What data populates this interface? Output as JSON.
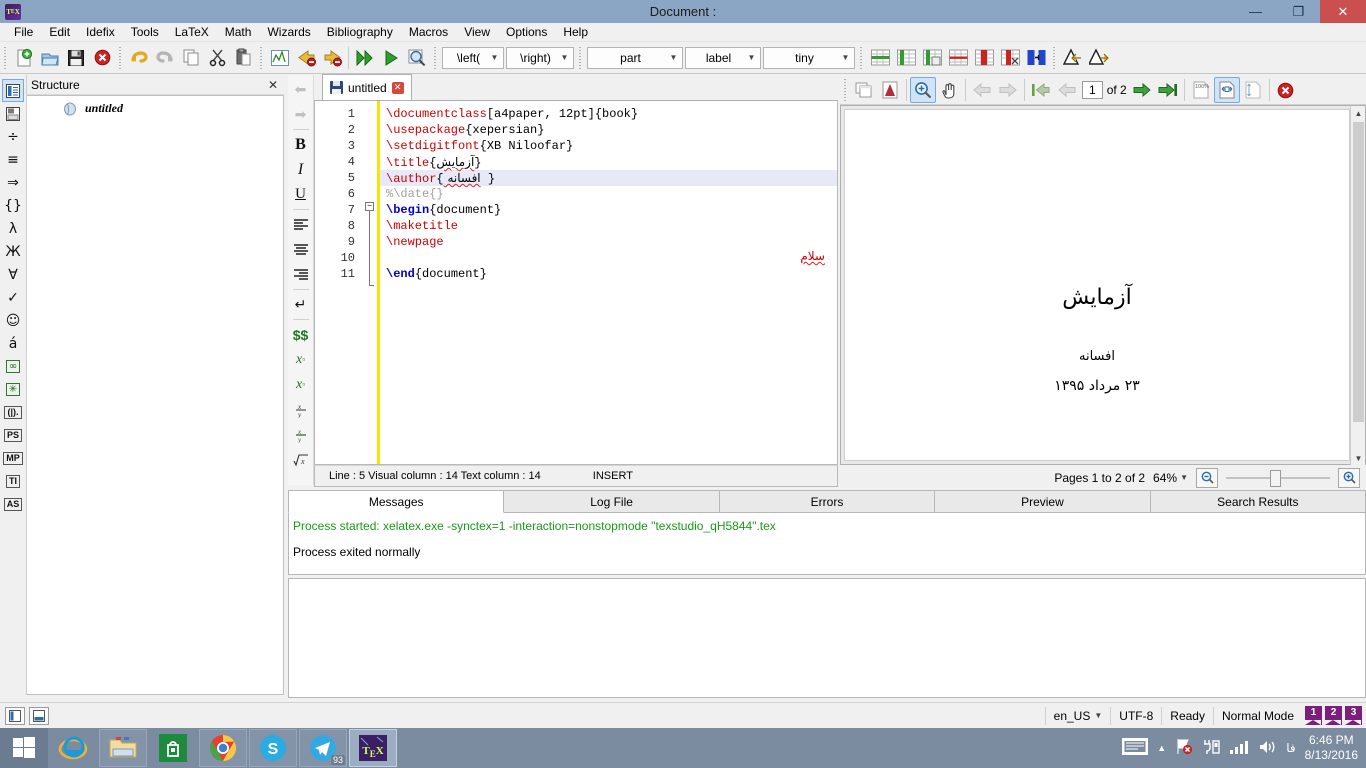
{
  "window": {
    "title": "Document :",
    "minimize": "—",
    "maximize": "❐",
    "close": "✕",
    "app_icon": "texstudio-icon"
  },
  "menubar": {
    "items": [
      "File",
      "Edit",
      "Idefix",
      "Tools",
      "LaTeX",
      "Math",
      "Wizards",
      "Bibliography",
      "Macros",
      "View",
      "Options",
      "Help"
    ]
  },
  "toolbar": {
    "groups": [
      [
        "new-file-icon",
        "open-file-icon",
        "save-file-icon",
        "close-file-icon"
      ],
      [
        "undo-icon",
        "redo-icon",
        "copy-icon",
        "cut-icon",
        "paste-icon"
      ],
      [
        "structure-chart-icon",
        "previous-error-icon",
        "next-error-icon",
        "build-and-view-icon",
        "quick-build-icon",
        "view-log-icon"
      ]
    ],
    "combos": [
      {
        "name": "left-bracket-combo",
        "value": "\\left("
      },
      {
        "name": "right-bracket-combo",
        "value": "\\right)"
      },
      {
        "name": "section-combo",
        "value": "part"
      },
      {
        "name": "label-combo",
        "value": "label"
      },
      {
        "name": "fontsize-combo",
        "value": "tiny"
      }
    ],
    "table_icons": [
      "add-row-icon",
      "add-column-icon",
      "paste-column-icon",
      "remove-row-icon",
      "remove-column-icon",
      "cut-column-icon",
      "align-column-icon"
    ],
    "end_icons": [
      "previous-mark-icon",
      "next-mark-icon"
    ]
  },
  "vertical_toolbar": {
    "items": [
      {
        "name": "structure-view-icon",
        "glyph": "▤",
        "selected": true
      },
      {
        "name": "bookmarks-view-icon",
        "glyph": "⊟",
        "selected": false
      },
      {
        "name": "relation-symbols-icon",
        "glyph": "÷",
        "selected": false
      },
      {
        "name": "arrows-symbols-icon",
        "glyph": "≡",
        "selected": false
      },
      {
        "name": "implies-symbols-icon",
        "glyph": "⇒",
        "selected": false
      },
      {
        "name": "delimiters-symbols-icon",
        "glyph": "{}",
        "selected": false
      },
      {
        "name": "greek-symbols-icon",
        "glyph": "λ",
        "selected": false
      },
      {
        "name": "cyrillic-symbols-icon",
        "glyph": "Ж",
        "selected": false
      },
      {
        "name": "misc-math-symbols-icon",
        "glyph": "∀",
        "selected": false
      },
      {
        "name": "misc-text-symbols-icon",
        "glyph": "✓",
        "selected": false
      },
      {
        "name": "wasysym-icon",
        "glyph": "☺",
        "selected": false
      },
      {
        "name": "accents-icon",
        "glyph": "á",
        "selected": false
      },
      {
        "name": "infinity-icon",
        "glyph": "∞",
        "selected": false
      },
      {
        "name": "asterisk-icon",
        "glyph": "✳",
        "selected": false
      },
      {
        "name": "brackets-icon",
        "glyph": "(|).",
        "selected": false
      },
      {
        "name": "postscript-icon",
        "glyph": "PS",
        "selected": false
      },
      {
        "name": "metapost-icon",
        "glyph": "MP",
        "selected": false
      },
      {
        "name": "tikz-icon",
        "glyph": "TI",
        "selected": false
      },
      {
        "name": "asymptote-icon",
        "glyph": "AS",
        "selected": false
      }
    ]
  },
  "structure": {
    "title": "Structure",
    "close_label": "✕",
    "root_item": "untitled"
  },
  "editor_format_toolbar": {
    "items": [
      {
        "name": "navigate-back-icon",
        "glyph": "⬅"
      },
      {
        "name": "navigate-forward-icon",
        "glyph": "➡"
      },
      {
        "name": "bold-icon",
        "glyph": "B"
      },
      {
        "name": "italic-icon",
        "glyph": "I"
      },
      {
        "name": "underline-icon",
        "glyph": "U"
      },
      {
        "name": "align-left-icon",
        "glyph": "≣"
      },
      {
        "name": "align-center-icon",
        "glyph": "≣"
      },
      {
        "name": "align-right-icon",
        "glyph": "≣"
      },
      {
        "name": "newline-icon",
        "glyph": "↵"
      },
      {
        "name": "inline-math-icon",
        "glyph": "$$"
      },
      {
        "name": "subscript-icon",
        "glyph": "x□"
      },
      {
        "name": "superscript-icon",
        "glyph": "x□"
      },
      {
        "name": "frac-icon",
        "glyph": "x/y"
      },
      {
        "name": "dfrac-icon",
        "glyph": "x/y"
      },
      {
        "name": "sqrt-icon",
        "glyph": "√x"
      }
    ]
  },
  "editor": {
    "tab_label": "untitled",
    "tab_close": "✕",
    "lines": [
      {
        "num": "1",
        "parts": [
          {
            "t": "\\documentclass",
            "c": "cmd"
          },
          {
            "t": "[a4paper, 12pt]{book}",
            "c": "plain"
          }
        ]
      },
      {
        "num": "2",
        "parts": [
          {
            "t": "\\usepackage",
            "c": "cmd"
          },
          {
            "t": "{xepersian}",
            "c": "plain"
          }
        ]
      },
      {
        "num": "3",
        "parts": [
          {
            "t": "\\setdigitfont",
            "c": "cmd"
          },
          {
            "t": "{XB Niloofar}",
            "c": "plain"
          }
        ]
      },
      {
        "num": "4",
        "parts": [
          {
            "t": "\\title",
            "c": "cmd"
          },
          {
            "t": "{",
            "c": "plain"
          },
          {
            "t": "آزمایش",
            "c": "fa"
          },
          {
            "t": "}",
            "c": "plain"
          }
        ]
      },
      {
        "num": "5",
        "parts": [
          {
            "t": "\\author",
            "c": "cmd"
          },
          {
            "t": "{",
            "c": "plain"
          },
          {
            "t": "افسانه ",
            "c": "fa"
          },
          {
            "t": " }",
            "c": "plain"
          }
        ]
      },
      {
        "num": "6",
        "parts": [
          {
            "t": "%\\date{}",
            "c": "comment"
          }
        ]
      },
      {
        "num": "7",
        "parts": [
          {
            "t": "\\begin",
            "c": "cmdblue"
          },
          {
            "t": "{document}",
            "c": "plain"
          }
        ]
      },
      {
        "num": "8",
        "parts": [
          {
            "t": "\\maketitle",
            "c": "cmd"
          }
        ]
      },
      {
        "num": "9",
        "parts": [
          {
            "t": "\\newpage",
            "c": "cmd"
          }
        ]
      },
      {
        "num": "10",
        "parts": []
      },
      {
        "num": "11",
        "parts": [
          {
            "t": "\\end",
            "c": "cmdblue"
          },
          {
            "t": "{document}",
            "c": "plain"
          }
        ]
      }
    ],
    "rtl_text_line10": "سلام",
    "highlight_line": 5,
    "fold_line": 7
  },
  "editor_status": {
    "position": "Line : 5 Visual column : 14 Text column : 14",
    "mode": "INSERT"
  },
  "pdf_toolbar": {
    "items": [
      {
        "name": "external-viewer-icon",
        "glyph": "▤"
      },
      {
        "name": "open-pdf-icon",
        "glyph": "A"
      },
      {
        "name": "magnify-tool-icon",
        "glyph": "🔍",
        "active": true
      },
      {
        "name": "pan-tool-icon",
        "glyph": "✋"
      },
      {
        "name": "back-icon",
        "glyph": "⬅"
      },
      {
        "name": "forward-icon",
        "glyph": "➡"
      },
      {
        "name": "first-page-icon",
        "glyph": "⏮"
      },
      {
        "name": "previous-page-icon",
        "glyph": "⬅"
      },
      {
        "name": "next-page-icon",
        "glyph": "➡"
      },
      {
        "name": "last-page-icon",
        "glyph": "⏭"
      },
      {
        "name": "zoom-100-icon",
        "glyph": "100%"
      },
      {
        "name": "fit-width-icon",
        "glyph": "↔",
        "active": true
      },
      {
        "name": "fit-page-icon",
        "glyph": "↕"
      },
      {
        "name": "close-viewer-icon",
        "glyph": "✕"
      }
    ],
    "page_number": "1",
    "page_of": "of 2"
  },
  "pdf_page": {
    "title": "آزمایش",
    "author": "افسانه",
    "date": "۲۳ مرداد ۱۳۹۵"
  },
  "pdf_status": {
    "pages": "Pages 1 to 2 of 2",
    "zoom": "64%",
    "zoom_out_icon": "zoom-out-icon",
    "zoom_in_icon": "zoom-in-icon"
  },
  "message_panel": {
    "tabs": [
      "Messages",
      "Log File",
      "Errors",
      "Preview",
      "Search Results"
    ],
    "selected_tab": "Messages",
    "lines": [
      {
        "text": "Process started: xelatex.exe -synctex=1 -interaction=nonstopmode \"texstudio_qH5844\".tex",
        "color": "green"
      },
      {
        "text": "Process exited normally",
        "color": "black"
      }
    ]
  },
  "statusbar": {
    "view_buttons": [
      "toggle-structure-view-icon",
      "toggle-message-view-icon"
    ],
    "language": "en_US",
    "encoding": "UTF-8",
    "state": "Ready",
    "mode": "Normal Mode",
    "bookmarks": [
      "1",
      "2",
      "3"
    ]
  },
  "taskbar": {
    "start": "start-button",
    "apps": [
      {
        "name": "internet-explorer-icon",
        "badge": ""
      },
      {
        "name": "file-explorer-icon",
        "badge": ""
      },
      {
        "name": "windows-store-icon",
        "badge": ""
      },
      {
        "name": "google-chrome-icon",
        "badge": ""
      },
      {
        "name": "skype-icon",
        "badge": ""
      },
      {
        "name": "telegram-icon",
        "badge": "93"
      },
      {
        "name": "texstudio-icon",
        "badge": ""
      }
    ],
    "tray": {
      "keyboard_icon": "keyboard-icon",
      "show-hidden-icon": "▲",
      "action_center_icon": "flag-icon",
      "usb_icon": "usb-icon",
      "network_icon": "network-signal-icon",
      "volume_icon": "volume-icon",
      "language": "فا",
      "time": "6:46 PM",
      "date": "8/13/2016"
    }
  },
  "colors": {
    "titlebar": "#8ba5c4",
    "close_button": "#c9504f",
    "accent": "#cfe4f7",
    "taskbar": "#7b8ca1",
    "command": "#cc0000",
    "environment": "#0000cc",
    "success": "#1a9a1a"
  }
}
